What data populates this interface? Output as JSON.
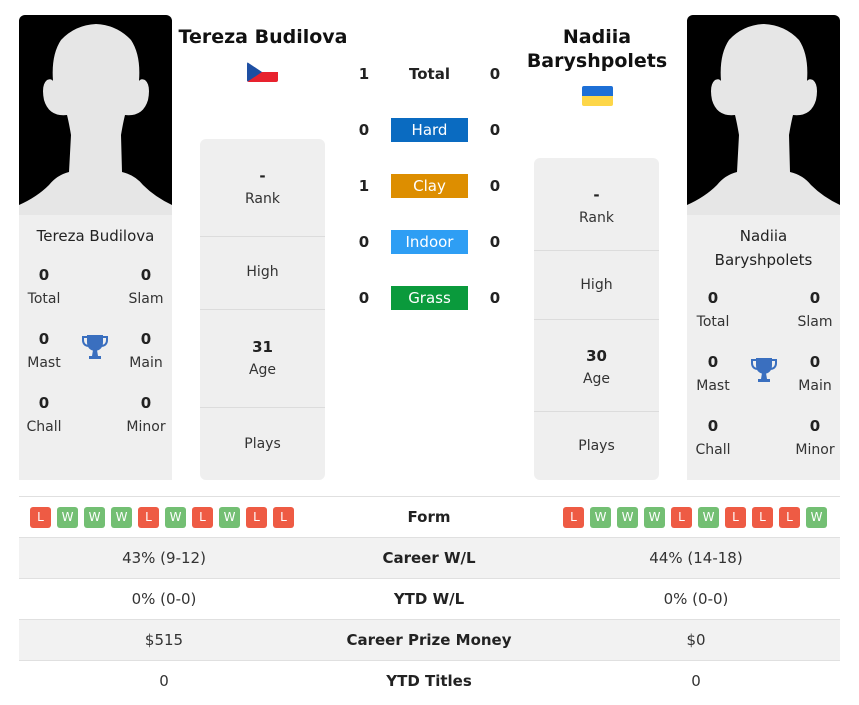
{
  "colors": {
    "hard": "#0a6bc1",
    "clay": "#dd8e00",
    "indoor": "#2e9ef4",
    "grass": "#0a9a3c",
    "loss": "#ee5b44",
    "win": "#73bf73",
    "trophy": "#3a6fbf"
  },
  "player1": {
    "name": "Tereza Budilova",
    "country_flag": "czech-republic-flag",
    "card_name": "Tereza Budilova",
    "titles": {
      "total": {
        "value": "0",
        "label": "Total"
      },
      "slam": {
        "value": "0",
        "label": "Slam"
      },
      "mast": {
        "value": "0",
        "label": "Mast"
      },
      "main": {
        "value": "0",
        "label": "Main"
      },
      "chall": {
        "value": "0",
        "label": "Chall"
      },
      "minor": {
        "value": "0",
        "label": "Minor"
      }
    },
    "info": {
      "rank": {
        "value": "-",
        "label": "Rank"
      },
      "high": {
        "value": "",
        "label": "High"
      },
      "age": {
        "value": "31",
        "label": "Age"
      },
      "plays": {
        "value": "",
        "label": "Plays"
      }
    },
    "form": [
      "L",
      "W",
      "W",
      "W",
      "L",
      "W",
      "L",
      "W",
      "L",
      "L"
    ],
    "career_wl": "43% (9-12)",
    "ytd_wl": "0% (0-0)",
    "career_prize": "$515",
    "ytd_titles": "0"
  },
  "player2": {
    "name_line1": "Nadiia",
    "name_line2": "Baryshpolets",
    "country_flag": "ukraine-flag",
    "card_name_line1": "Nadiia",
    "card_name_line2": "Baryshpolets",
    "titles": {
      "total": {
        "value": "0",
        "label": "Total"
      },
      "slam": {
        "value": "0",
        "label": "Slam"
      },
      "mast": {
        "value": "0",
        "label": "Mast"
      },
      "main": {
        "value": "0",
        "label": "Main"
      },
      "chall": {
        "value": "0",
        "label": "Chall"
      },
      "minor": {
        "value": "0",
        "label": "Minor"
      }
    },
    "info": {
      "rank": {
        "value": "-",
        "label": "Rank"
      },
      "high": {
        "value": "",
        "label": "High"
      },
      "age": {
        "value": "30",
        "label": "Age"
      },
      "plays": {
        "value": "",
        "label": "Plays"
      }
    },
    "form": [
      "L",
      "W",
      "W",
      "W",
      "L",
      "W",
      "L",
      "L",
      "L",
      "W"
    ],
    "career_wl": "44% (14-18)",
    "ytd_wl": "0% (0-0)",
    "career_prize": "$0",
    "ytd_titles": "0"
  },
  "h2h": [
    {
      "label": "Total",
      "p1": "1",
      "p2": "0"
    },
    {
      "label": "Hard",
      "p1": "0",
      "p2": "0"
    },
    {
      "label": "Clay",
      "p1": "1",
      "p2": "0"
    },
    {
      "label": "Indoor",
      "p1": "0",
      "p2": "0"
    },
    {
      "label": "Grass",
      "p1": "0",
      "p2": "0"
    }
  ],
  "comparison_labels": {
    "form": "Form",
    "career_wl": "Career W/L",
    "ytd_wl": "YTD W/L",
    "career_prize": "Career Prize Money",
    "ytd_titles": "YTD Titles"
  }
}
